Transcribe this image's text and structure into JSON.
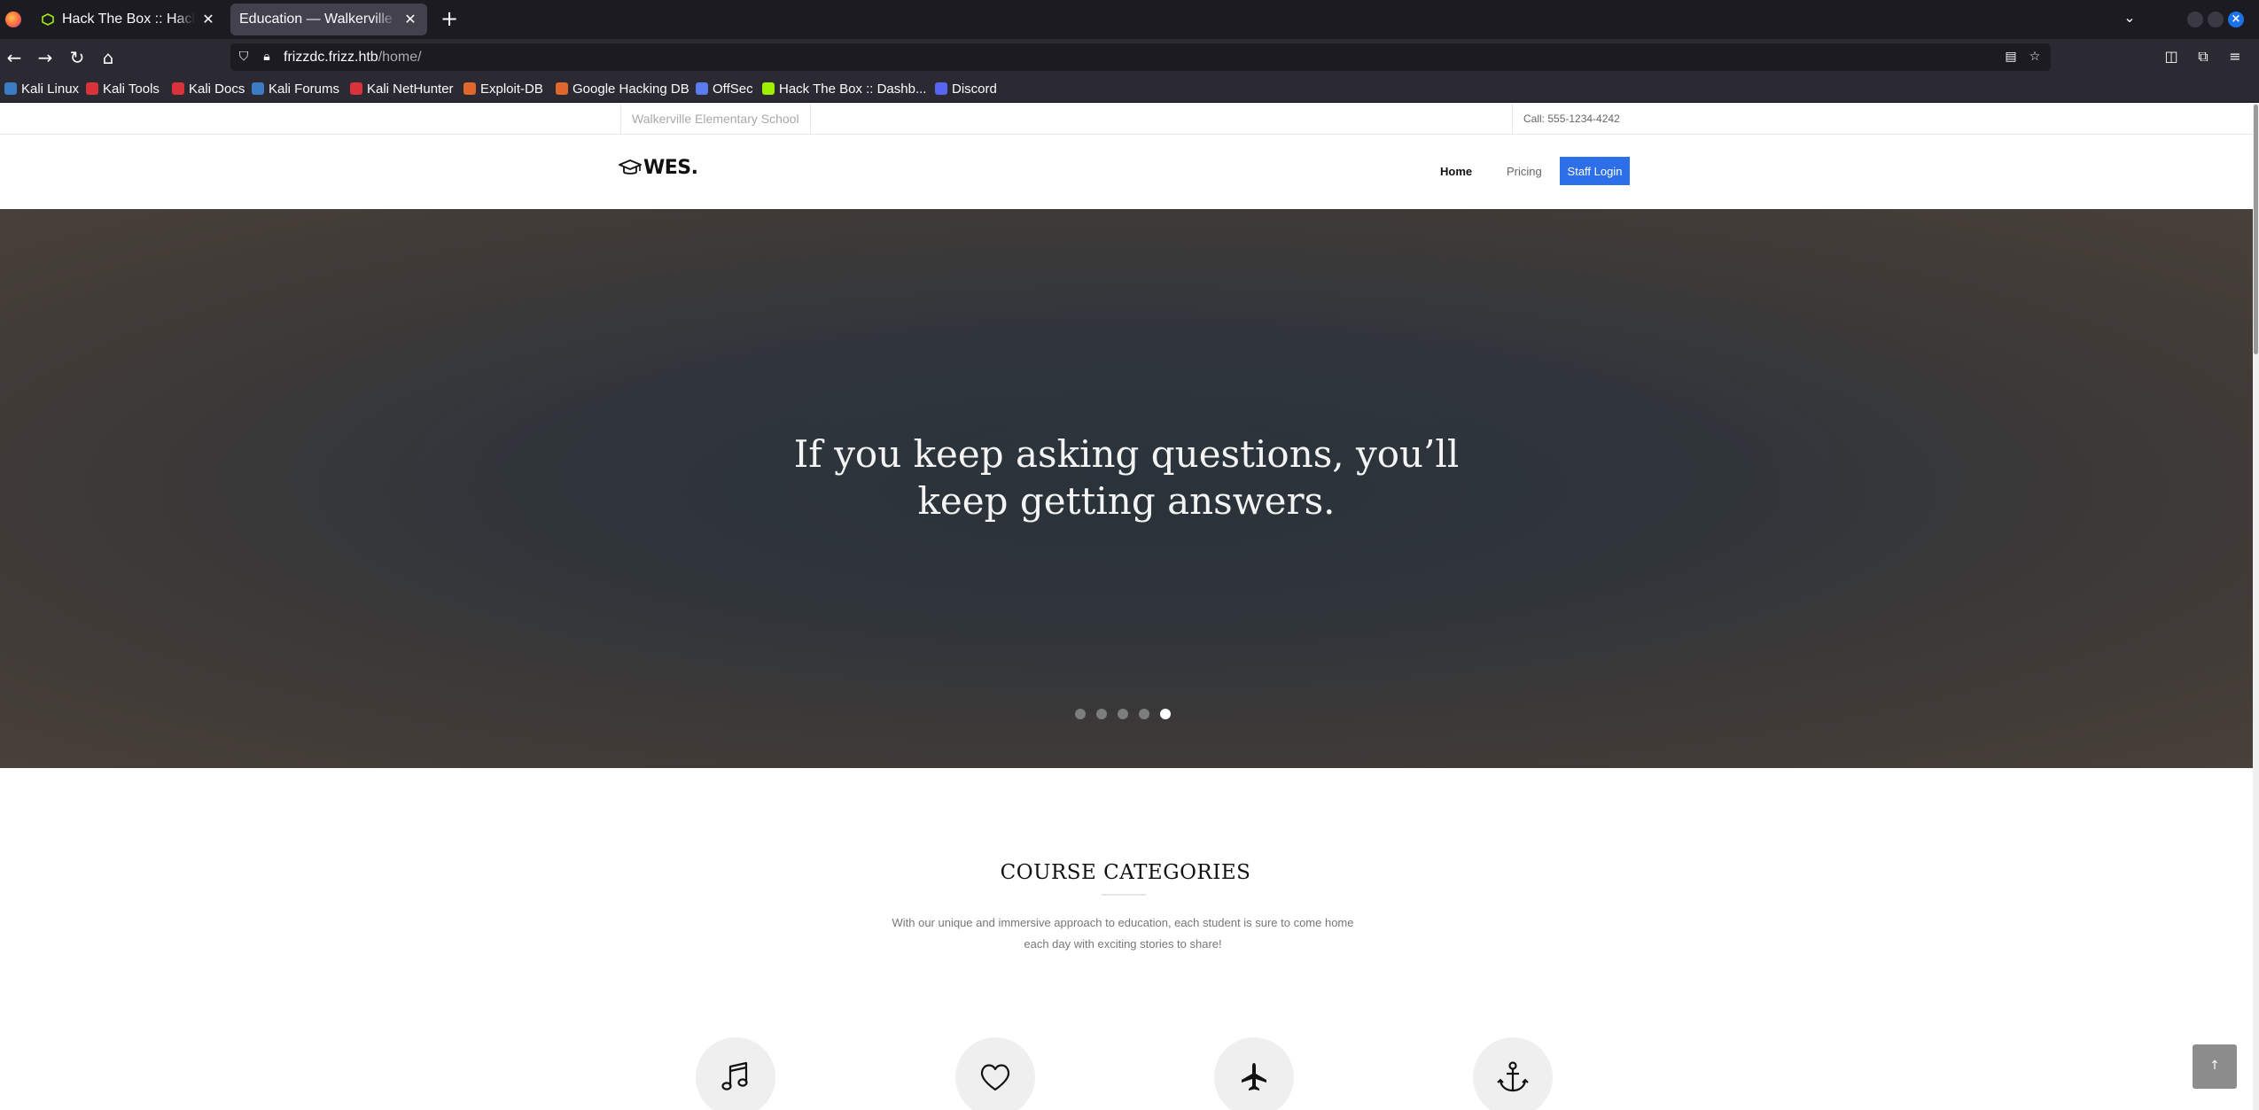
{
  "browser": {
    "tabs": [
      {
        "title": "Hack The Box :: Hack The",
        "active": false
      },
      {
        "title": "Education — Walkerville Ele",
        "active": true
      }
    ],
    "url": {
      "host": "frizzdc.frizz.htb",
      "path": "/home/"
    },
    "bookmarks": [
      {
        "label": "Kali Linux",
        "color": "#3b7cc4"
      },
      {
        "label": "Kali Tools",
        "color": "#d9323a"
      },
      {
        "label": "Kali Docs",
        "color": "#d9323a"
      },
      {
        "label": "Kali Forums",
        "color": "#3b7cc4"
      },
      {
        "label": "Kali NetHunter",
        "color": "#d9323a"
      },
      {
        "label": "Exploit-DB",
        "color": "#e0662b"
      },
      {
        "label": "Google Hacking DB",
        "color": "#e0662b"
      },
      {
        "label": "OffSec",
        "color": "#5a7cf0"
      },
      {
        "label": "Hack The Box :: Dashb...",
        "color": "#9fef00"
      },
      {
        "label": "Discord",
        "color": "#5865f2"
      }
    ]
  },
  "site": {
    "school_name": "Walkerville Elementary School",
    "phone": "Call: 555-1234-4242",
    "logo_text": "WES.",
    "menu": {
      "home": "Home",
      "pricing": "Pricing",
      "login": "Staff Login"
    },
    "accent_color": "#2d6fe8",
    "hero": {
      "quote": "If you keep asking questions, you’ll keep getting answers.",
      "slide_count": 5,
      "active_slide": 5
    },
    "courses": {
      "title": "COURSE CATEGORIES",
      "subtitle": "With our unique and immersive approach to education, each student is sure to come home each day with exciting stories to share!",
      "icons": [
        "music-note-icon",
        "heart-icon",
        "airplane-icon",
        "anchor-icon"
      ]
    },
    "back_to_top": "↑"
  }
}
